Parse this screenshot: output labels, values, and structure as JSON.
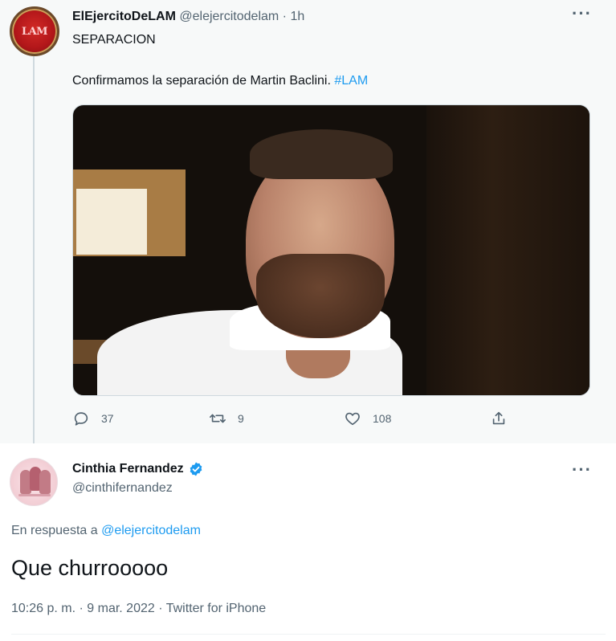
{
  "tweet1": {
    "avatar_text": "LAM",
    "author_name": "ElEjercitoDeLAM",
    "author_handle": "@elejercitodelam",
    "separator": " · ",
    "time": "1h",
    "heading": "SEPARACION",
    "body_text": "Confirmamos la separación de Martin Baclini. ",
    "hashtag": "#LAM",
    "more_icon": "more-horizontal-icon",
    "actions": {
      "reply_count": "37",
      "retweet_count": "9",
      "like_count": "108"
    }
  },
  "tweet2": {
    "author_name": "Cinthia Fernandez",
    "author_handle": "@cinthifernandez",
    "verified": true,
    "reply_prefix": "En respuesta a ",
    "reply_to": "@elejercitodelam",
    "body": "Que churrooooo",
    "timestamp": "10:26 p. m. · 9 mar. 2022 · Twitter for iPhone"
  },
  "colors": {
    "accent": "#1d9bf0",
    "secondary_text": "#536471",
    "primary_text": "#0f1419",
    "thread_bg": "#f7f9f9"
  }
}
